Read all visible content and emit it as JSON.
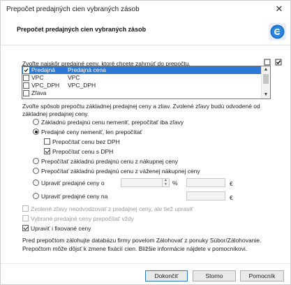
{
  "window": {
    "title": "Prepočet predajných cien vybraných zásob",
    "close_glyph": "✕"
  },
  "header": {
    "title": "Prepočet predajných cien vybraných zásob",
    "logo_icon": "blue-circle-e-logo"
  },
  "instruction": "Zvoľte najskôr predajné ceny, ktoré chcete zahrnúť do prepočtu.",
  "price_list": {
    "rows": [
      {
        "code": "Predajná",
        "name": "Predajná cena",
        "checked": true,
        "selected": true
      },
      {
        "code": "VPC",
        "name": "VPC",
        "checked": false,
        "selected": false
      },
      {
        "code": "VPC_DPH",
        "name": "VPC_DPH",
        "checked": false,
        "selected": false
      },
      {
        "code": "Zľava",
        "name": "",
        "checked": false,
        "selected": false
      }
    ]
  },
  "method_description": "Zvoľte spôsob prepočtu základnej predajnej ceny a zliav. Zvolené zľavy budú odvodené od základnej predajnej ceny.",
  "options": {
    "opt1": "Základnú predajnú cenu nemeniť, prepočítať iba zľavy",
    "opt2": "Predajné ceny nemeniť, len prepočítať",
    "sub1": "Prepočítať cenu bez DPH",
    "sub2": "Prepočítať cenu s DPH",
    "opt3": "Prepočítať základnú predajnú cenu z nákupnej ceny",
    "opt4": "Prepočítať základnú predajnú cenu z váženej nákupnej ceny",
    "opt5": "Upraviť predajné ceny o",
    "opt6": "Upraviť predajné ceny na",
    "percent_unit": "%",
    "currency_unit": "€"
  },
  "checks": {
    "c1": "Zvolené zľavy neodvodzovať z predajnej ceny, ale tiež upraviť",
    "c2": "Vybrané predajné ceny prepočítať vždy",
    "c3": "Upraviť i fixované ceny"
  },
  "info": {
    "line1": "Pred prepočtom zálohujte databázu firmy povelom Zálohovať z ponuky Súbor/Zálohovanie.",
    "line2": "Prepočtom môže dôjsť k zmene fixácií cien. Bližšie informácie nájdete v pomocníkovi."
  },
  "buttons": {
    "ok": "Dokončiť",
    "cancel": "Storno",
    "help": "Pomocník"
  },
  "colors": {
    "selection": "#2f79d6",
    "logo": "#1f6fc7"
  }
}
